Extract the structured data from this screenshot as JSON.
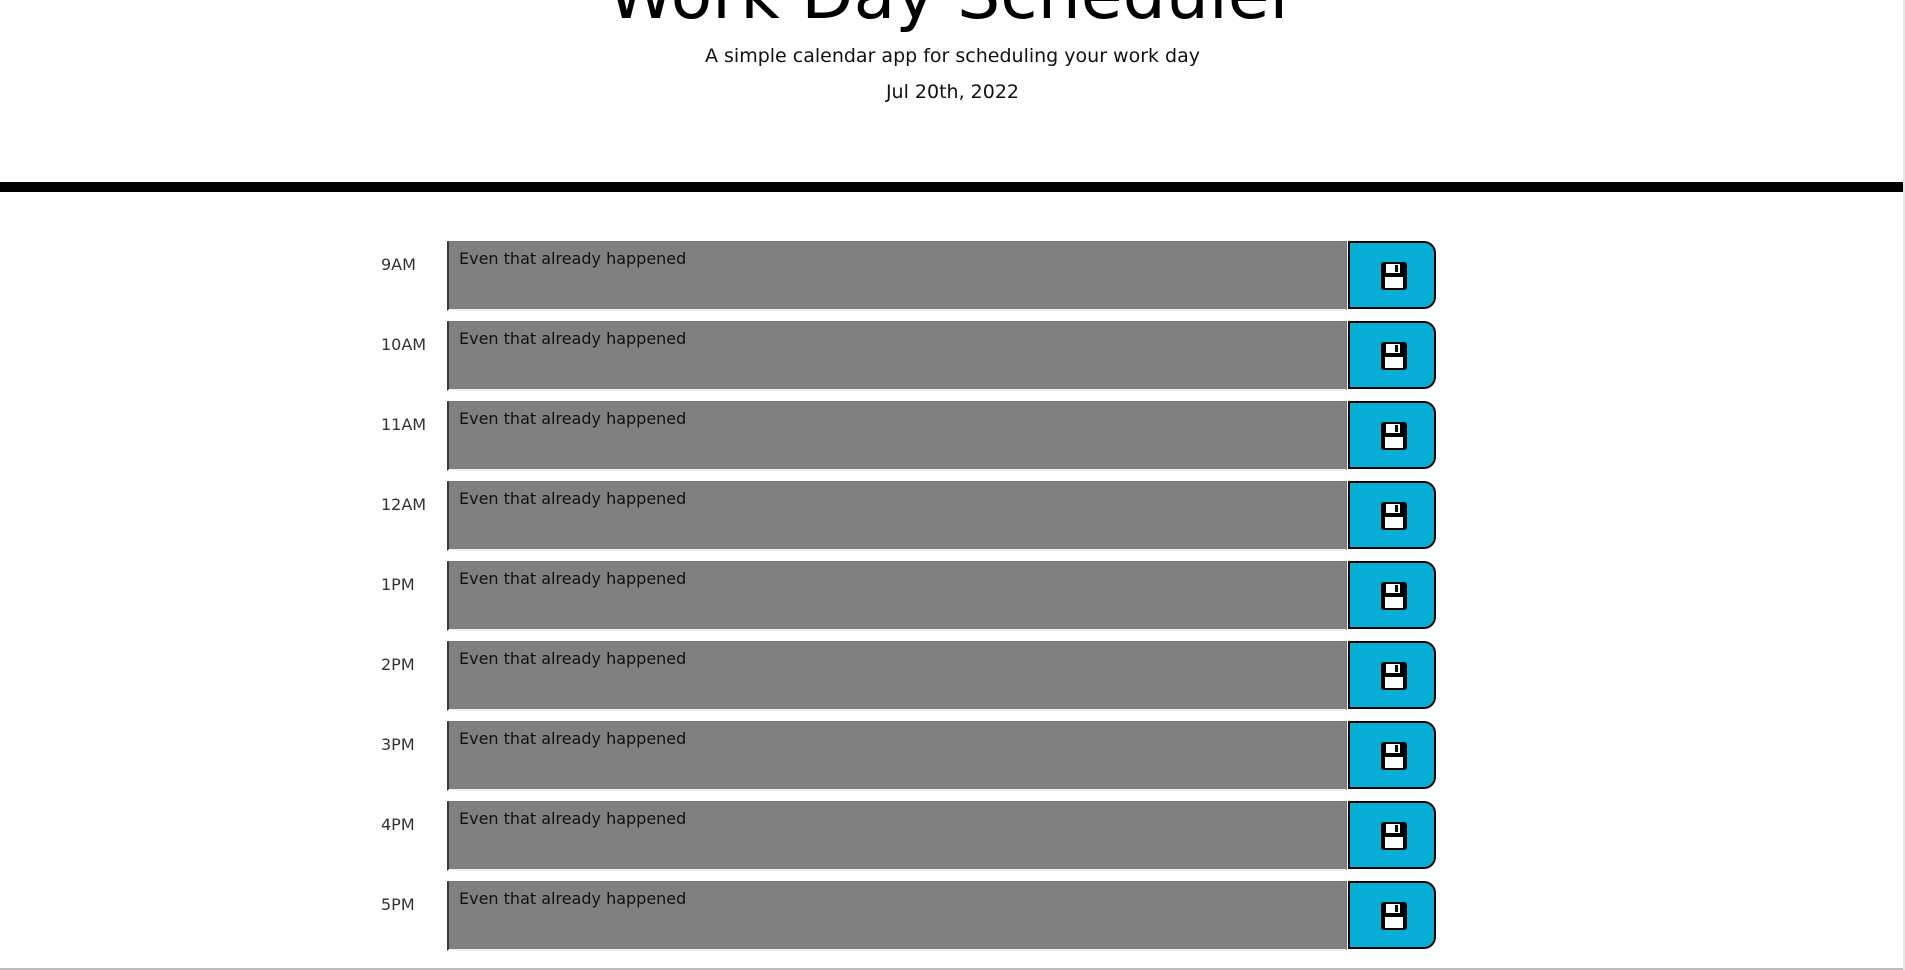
{
  "header": {
    "title": "Work Day Scheduler",
    "subtitle": "A simple calendar app for scheduling your work day",
    "current_date": "Jul 20th, 2022"
  },
  "rows": [
    {
      "hour": "9AM",
      "text": "Even that already happened"
    },
    {
      "hour": "10AM",
      "text": "Even that already happened"
    },
    {
      "hour": "11AM",
      "text": "Even that already happened"
    },
    {
      "hour": "12AM",
      "text": "Even that already happened"
    },
    {
      "hour": "1PM",
      "text": "Even that already happened"
    },
    {
      "hour": "2PM",
      "text": "Even that already happened"
    },
    {
      "hour": "3PM",
      "text": "Even that already happened"
    },
    {
      "hour": "4PM",
      "text": "Even that already happened"
    },
    {
      "hour": "5PM",
      "text": "Even that already happened"
    }
  ],
  "icons": {
    "save": "save-icon"
  },
  "colors": {
    "past_row": "#808080",
    "save_button": "#06aed5",
    "divider": "#000000"
  }
}
